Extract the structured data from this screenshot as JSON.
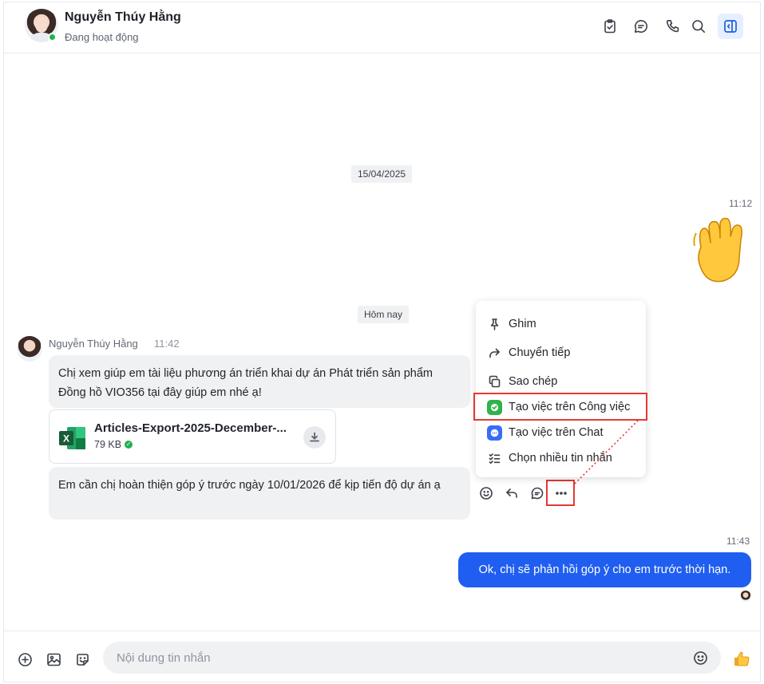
{
  "header": {
    "name": "Nguyễn Thúy Hằng",
    "status": "Đang hoạt động",
    "icons": [
      "task-icon",
      "chat-bubble-icon",
      "phone-icon",
      "search-icon",
      "side-panel-icon"
    ]
  },
  "messages": {
    "date_old": "15/04/2025",
    "time_wave": "11:12",
    "wave_emoji": "👋",
    "date_today": "Hôm nay",
    "sender_name": "Nguyễn Thúy Hằng",
    "sender_time": "11:42",
    "msg1": "Chị xem giúp em tài liệu phương án triển khai dự án Phát triển sản phẩm Đồng hồ VIO356 tại đây giúp em nhé ạ!",
    "file": {
      "name": "Articles-Export-2025-December-...",
      "size": "79 KB"
    },
    "msg2": "Em cần chị hoàn thiện góp ý trước ngày 10/01/2026 để kịp tiến độ dự án ạ",
    "reply_time": "11:43",
    "reply": "Ok, chị sẽ phản hồi góp ý cho em trước thời hạn."
  },
  "menu": {
    "pin": "Ghim",
    "forward": "Chuyển tiếp",
    "copy": "Sao chép",
    "create_task_work": "Tạo việc trên Công việc",
    "create_task_chat": "Tạo việc trên Chat",
    "select_multiple": "Chọn nhiều tin nhắn"
  },
  "composer": {
    "placeholder": "Nội dung tin nhắn"
  },
  "colors": {
    "accent": "#1f5ef0",
    "online": "#22b14c",
    "highlight": "#e53935"
  }
}
